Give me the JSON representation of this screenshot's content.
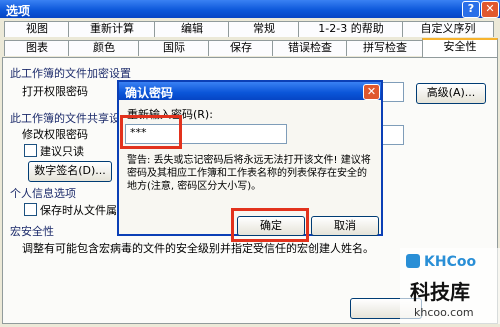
{
  "window": {
    "title": "选项",
    "help_icon": "?",
    "close_icon": "✕"
  },
  "tabs_row1": [
    "视图",
    "重新计算",
    "编辑",
    "常规",
    "1-2-3 的帮助",
    "自定义序列"
  ],
  "tabs_row2": [
    "图表",
    "颜色",
    "国际",
    "保存",
    "错误检查",
    "拼写检查",
    "安全性"
  ],
  "security": {
    "encrypt_group": "此工作簿的文件加密设置",
    "open_password_label": "打开权限密码",
    "advanced_button": "高级(A)...",
    "share_group": "此工作簿的文件共享设",
    "modify_password_label": "修改权限密码",
    "readonly_label": "建议只读",
    "digital_signature_button": "数字签名(D)...",
    "privacy_group": "个人信息选项",
    "remove_personal_label": "保存时从文件属性",
    "macro_group": "宏安全性",
    "macro_text": "调整有可能包含宏病毒的文件的安全级别并指定受信任的宏创建人姓名。"
  },
  "modal": {
    "title": "确认密码",
    "reenter_label": "重新输入密码(R):",
    "password_value": "***",
    "warning_text": "警告: 丢失或忘记密码后将永远无法打开该文件! 建议将密码及其相应工作簿和工作表名称的列表保存在安全的地方(注意, 密码区分大小写)。",
    "ok_button": "确定",
    "cancel_button": "取消"
  },
  "watermark": {
    "brand": "KHCoo",
    "name": "科技库",
    "url": "khcoo.com"
  },
  "colors": {
    "titlebar": "#0a55d8",
    "highlight": "#e2321d",
    "dialog_bg": "#ece9d8"
  }
}
